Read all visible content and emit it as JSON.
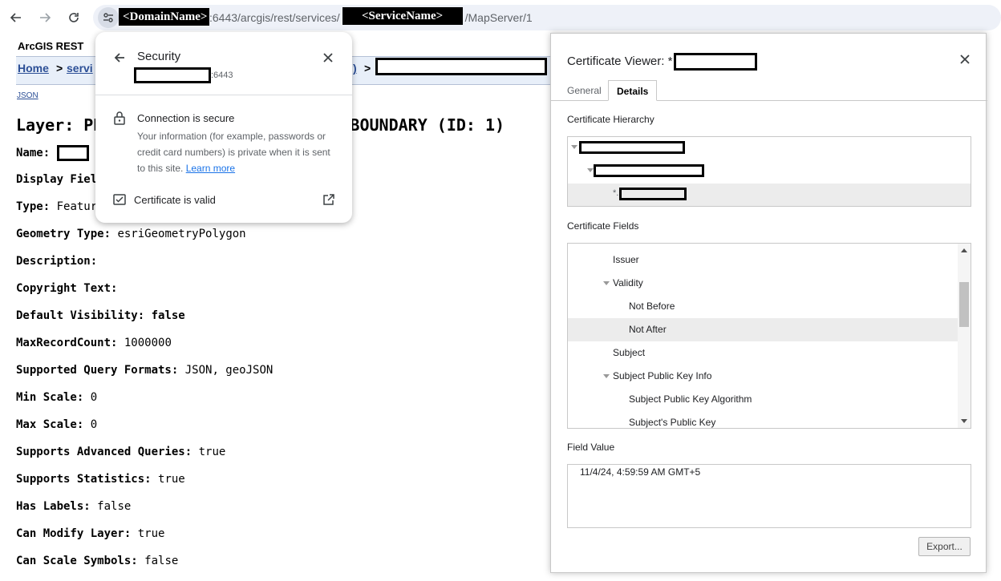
{
  "browser": {
    "url": {
      "domain_label": "<DomainName>",
      "part1": ":6443/arcgis/rest/services/",
      "service_label": "<ServiceName>",
      "part2": "/MapServer/1"
    }
  },
  "page": {
    "header_title": "ArcGIS REST",
    "breadcrumb": {
      "home": "Home",
      "sep1": ">",
      "services": "servi",
      "frag": ")",
      "sep2": ">"
    },
    "json_link": "JSON",
    "layer_heading_left": "Layer: PD",
    "layer_heading_right": "_BOUNDARY (ID: 1)",
    "properties": [
      {
        "label": "Name:",
        "value": ""
      },
      {
        "label": "Display Field",
        "value": ""
      },
      {
        "label": "Type:",
        "value": "Featur"
      },
      {
        "label": "Geometry Type:",
        "value": "esriGeometryPolygon"
      },
      {
        "label": "Description:",
        "value": ""
      },
      {
        "label": "Copyright Text:",
        "value": ""
      },
      {
        "label": "Default Visibility:",
        "value": "false"
      },
      {
        "label": "MaxRecordCount:",
        "value": "1000000"
      },
      {
        "label": "Supported Query Formats:",
        "value": "JSON, geoJSON"
      },
      {
        "label": "Min Scale:",
        "value": "0"
      },
      {
        "label": "Max Scale:",
        "value": "0"
      },
      {
        "label": "Supports Advanced Queries:",
        "value": "true"
      },
      {
        "label": "Supports Statistics:",
        "value": "true"
      },
      {
        "label": "Has Labels:",
        "value": "false"
      },
      {
        "label": "Can Modify Layer:",
        "value": "true"
      },
      {
        "label": "Can Scale Symbols:",
        "value": "false"
      }
    ]
  },
  "security_popup": {
    "title": "Security",
    "subtitle_suffix": ":6443",
    "connection_title": "Connection is secure",
    "connection_info": "Your information (for example, passwords or credit card numbers) is private when it is sent to this site.",
    "learn_more": "Learn more",
    "certificate": "Certificate is valid"
  },
  "certificate_viewer": {
    "title": "Certificate Viewer: *",
    "tabs": [
      "General",
      "Details"
    ],
    "active_tab": "Details",
    "hierarchy_label": "Certificate Hierarchy",
    "hierarchy_leaf_prefix": "*.",
    "fields_label": "Certificate Fields",
    "fields": [
      {
        "label": "Issuer",
        "expanded": false
      },
      {
        "label": "Validity",
        "expanded": true
      },
      {
        "label": "Not Before",
        "expanded": false
      },
      {
        "label": "Not After",
        "expanded": false,
        "selected": true
      },
      {
        "label": "Subject",
        "expanded": false
      },
      {
        "label": "Subject Public Key Info",
        "expanded": true
      },
      {
        "label": "Subject Public Key Algorithm",
        "expanded": false
      },
      {
        "label": "Subject's Public Key",
        "expanded": false
      }
    ],
    "value_label": "Field Value",
    "value": "11/4/24, 4:59:59 AM GMT+5",
    "export_label": "Export..."
  }
}
